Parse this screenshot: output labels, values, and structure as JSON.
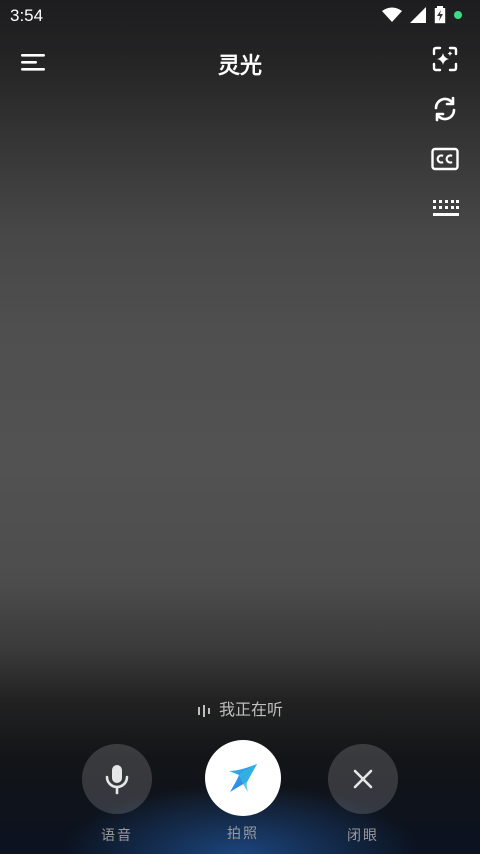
{
  "status_bar": {
    "time": "3:54"
  },
  "header": {
    "title": "灵光"
  },
  "listening": {
    "text": "我正在听"
  },
  "controls": {
    "voice_label": "语音",
    "photo_label": "拍照",
    "close_label": "闭眼"
  },
  "icons": {
    "menu": "menu-icon",
    "sparkle": "sparkle-frame-icon",
    "refresh": "refresh-icon",
    "captions": "closed-captions-icon",
    "keyboard": "keyboard-icon",
    "mic": "microphone-icon",
    "star": "star-icon",
    "close": "close-icon"
  },
  "colors": {
    "status_dot": "#3ddc84",
    "background": "#4f4f4f"
  }
}
